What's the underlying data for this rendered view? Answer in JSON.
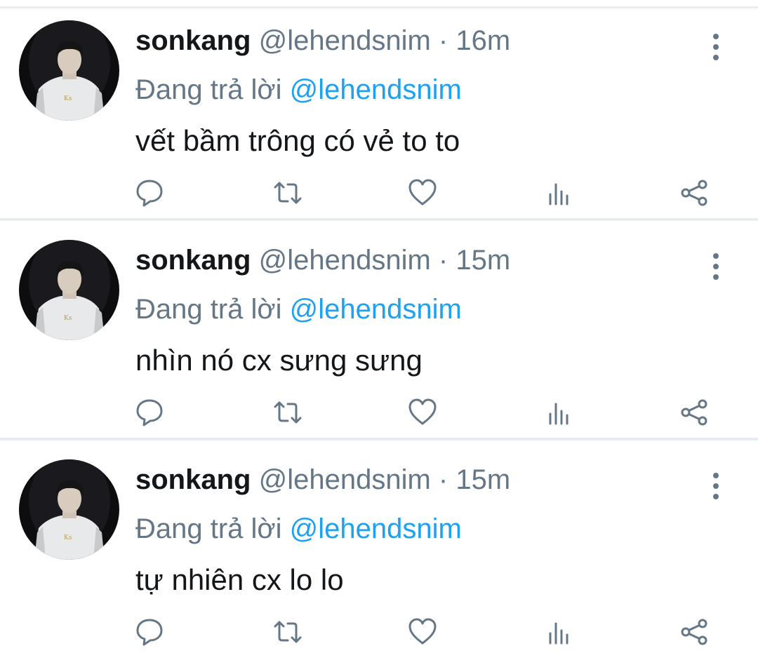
{
  "colors": {
    "text": "#14171a",
    "muted": "#657786",
    "accent": "#1da1f2",
    "divider": "#e6ecf0"
  },
  "tweets": [
    {
      "name": "sonkang",
      "handle": "@lehendsnim",
      "separator": "·",
      "time": "16m",
      "reply_prefix": "Đang trả lời",
      "reply_handle": "@lehendsnim",
      "text": "vết bầm trông có vẻ to to"
    },
    {
      "name": "sonkang",
      "handle": "@lehendsnim",
      "separator": "·",
      "time": "15m",
      "reply_prefix": "Đang trả lời",
      "reply_handle": "@lehendsnim",
      "text": "nhìn nó cx sưng sưng"
    },
    {
      "name": "sonkang",
      "handle": "@lehendsnim",
      "separator": "·",
      "time": "15m",
      "reply_prefix": "Đang trả lời",
      "reply_handle": "@lehendsnim",
      "text": "tự nhiên cx lo lo"
    }
  ],
  "icons": {
    "more": "more-vertical-icon",
    "reply": "reply-bubble-icon",
    "retweet": "retweet-icon",
    "like": "heart-icon",
    "stats": "analytics-icon",
    "share": "share-icon"
  }
}
